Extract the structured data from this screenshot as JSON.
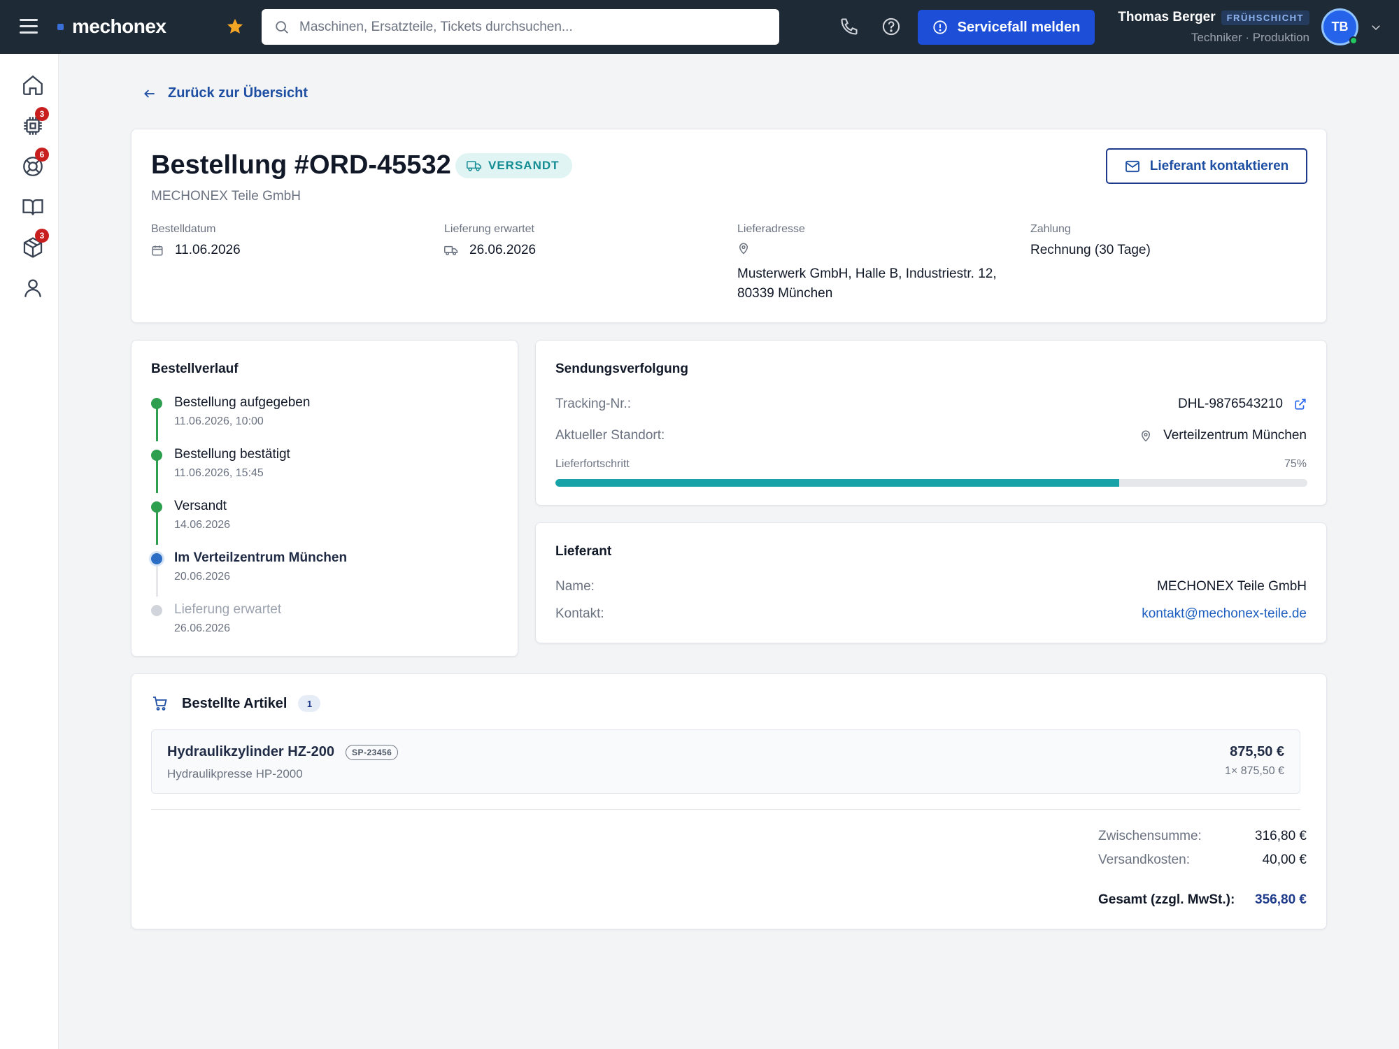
{
  "header": {
    "brand": "mechonex",
    "search_placeholder": "Maschinen, Ersatzteile, Tickets durchsuchen...",
    "service_button": "Servicefall melden",
    "user": {
      "name": "Thomas Berger",
      "shift": "FRÜHSCHICHT",
      "role": "Techniker · Produktion",
      "initials": "TB"
    }
  },
  "sidebar": {
    "items": [
      {
        "icon": "home-icon",
        "badge": null
      },
      {
        "icon": "chip-icon",
        "badge": "3"
      },
      {
        "icon": "lifebuoy-icon",
        "badge": "6"
      },
      {
        "icon": "book-icon",
        "badge": null
      },
      {
        "icon": "package-icon",
        "badge": "3"
      },
      {
        "icon": "user-icon",
        "badge": null
      }
    ]
  },
  "back_link": "Zurück zur Übersicht",
  "order": {
    "title": "Bestellung #ORD-45532",
    "status": "VERSANDT",
    "supplier": "MECHONEX Teile GmbH",
    "contact_button": "Lieferant kontaktieren",
    "meta": {
      "order_date_label": "Bestelldatum",
      "order_date": "11.06.2026",
      "delivery_label": "Lieferung erwartet",
      "delivery_date": "26.06.2026",
      "address_label": "Lieferadresse",
      "address": "Musterwerk GmbH, Halle B, Industriestr. 12, 80339 München",
      "payment_label": "Zahlung",
      "payment": "Rechnung (30 Tage)"
    }
  },
  "timeline": {
    "title": "Bestellverlauf",
    "steps": [
      {
        "title": "Bestellung aufgegeben",
        "date": "11.06.2026, 10:00",
        "state": "done"
      },
      {
        "title": "Bestellung bestätigt",
        "date": "11.06.2026, 15:45",
        "state": "done"
      },
      {
        "title": "Versandt",
        "date": "14.06.2026",
        "state": "done"
      },
      {
        "title": "Im Verteilzentrum München",
        "date": "20.06.2026",
        "state": "current"
      },
      {
        "title": "Lieferung erwartet",
        "date": "26.06.2026",
        "state": "pending"
      }
    ]
  },
  "tracking": {
    "title": "Sendungsverfolgung",
    "tracking_label": "Tracking-Nr.:",
    "tracking_number": "DHL-9876543210",
    "location_label": "Aktueller Standort:",
    "location": "Verteilzentrum München",
    "progress_label": "Lieferfortschritt",
    "progress_text": "75%",
    "progress_value": 0.75
  },
  "supplier_card": {
    "title": "Lieferant",
    "name_label": "Name:",
    "name": "MECHONEX Teile GmbH",
    "contact_label": "Kontakt:",
    "contact": "kontakt@mechonex-teile.de"
  },
  "items": {
    "title": "Bestellte Artikel",
    "count": "1",
    "list": [
      {
        "name": "Hydraulikzylinder HZ-200",
        "sku": "SP-23456",
        "machine": "Hydraulikpresse HP-2000",
        "price": "875,50 €",
        "unit": "1× 875,50 €"
      }
    ],
    "subtotal_label": "Zwischensumme:",
    "subtotal": "316,80 €",
    "shipping_label": "Versandkosten:",
    "shipping": "40,00 €",
    "total_label": "Gesamt (zzgl. MwSt.):",
    "total": "356,80 €"
  },
  "colors": {
    "topbar": "#1f2a37",
    "primary": "#1d4ed8",
    "teal": "#17a2a8",
    "success": "#2e9e4f",
    "current": "#2b6cc4",
    "badge_red": "#c81e1e"
  }
}
